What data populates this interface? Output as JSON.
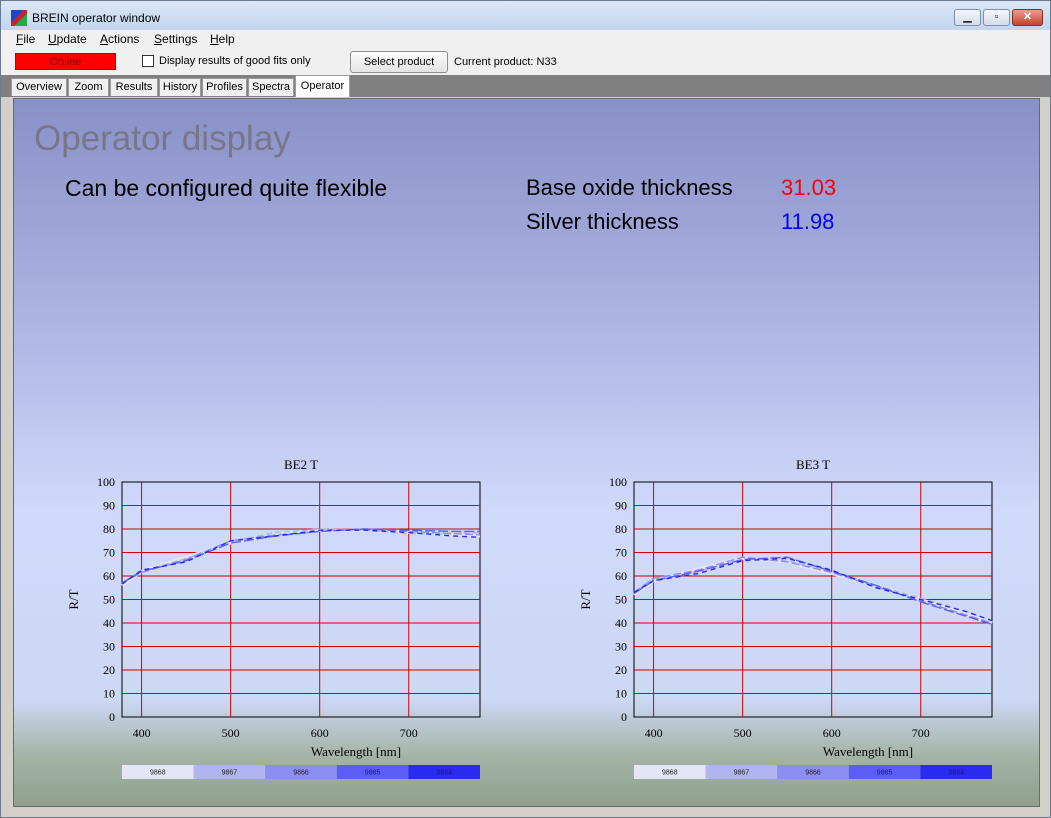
{
  "window": {
    "title": "BREIN operator window",
    "icon": "app-icon",
    "controls": {
      "minimize": "▁",
      "maximize": "▫",
      "close": "✕"
    }
  },
  "menu": [
    {
      "hot": "F",
      "rest": "ile"
    },
    {
      "hot": "U",
      "rest": "pdate"
    },
    {
      "hot": "A",
      "rest": "ctions"
    },
    {
      "hot": "S",
      "rest": "ettings"
    },
    {
      "hot": "H",
      "rest": "elp"
    }
  ],
  "toolbar": {
    "status": "Online",
    "status_color": "#ff0000",
    "checkbox_label": "Display results of good fits only",
    "checkbox_checked": false,
    "select_product_label": "Select product",
    "current_product": "Current product: N33"
  },
  "tabs": [
    "Overview",
    "Zoom",
    "Results",
    "History",
    "Profiles",
    "Spectra",
    "Operator"
  ],
  "active_tab": "Operator",
  "operator": {
    "title": "Operator display",
    "subtitle": "Can be configured quite flexible",
    "measurements": [
      {
        "label": "Base oxide thickness",
        "value": "31.03",
        "color": "#ff0000"
      },
      {
        "label": "Silver thickness",
        "value": "11.98",
        "color": "#0000ff"
      }
    ]
  },
  "chart_data": [
    {
      "type": "line",
      "title": "BE2 T",
      "xlabel": "Wavelength [nm]",
      "ylabel": "R/T",
      "xlim": [
        378,
        780
      ],
      "ylim": [
        0,
        100
      ],
      "xticks": [
        400,
        500,
        600,
        700
      ],
      "yticks": [
        0,
        10,
        20,
        30,
        40,
        50,
        60,
        70,
        80,
        90,
        100
      ],
      "grid": true,
      "grid_color": "#cc0000",
      "legend_placement": "bottom",
      "series": [
        {
          "name": "9868",
          "color": "#e4e6f8",
          "x": [
            378,
            400,
            450,
            500,
            550,
            600,
            650,
            700,
            750,
            780
          ],
          "y": [
            56,
            62,
            68,
            74,
            78,
            79.5,
            79.5,
            78.5,
            77.5,
            77
          ]
        },
        {
          "name": "9867",
          "color": "#b0b4f0",
          "x": [
            378,
            400,
            450,
            500,
            550,
            600,
            650,
            700,
            750,
            780
          ],
          "y": [
            57,
            62,
            67.5,
            74.5,
            78.5,
            80,
            79.5,
            78,
            78,
            78.5
          ]
        },
        {
          "name": "9866",
          "color": "#8a8ef0",
          "x": [
            378,
            400,
            450,
            500,
            550,
            600,
            650,
            700,
            750,
            780
          ],
          "y": [
            57,
            61.5,
            67,
            75,
            77.5,
            79,
            80,
            79,
            78,
            77.5
          ]
        },
        {
          "name": "9865",
          "color": "#5a5ef4",
          "x": [
            378,
            400,
            450,
            500,
            550,
            600,
            650,
            700,
            750,
            780
          ],
          "y": [
            57,
            62,
            66.5,
            74,
            77,
            79,
            80,
            79.5,
            79,
            79
          ]
        },
        {
          "name": "9864",
          "color": "#2a2af0",
          "x": [
            378,
            400,
            450,
            500,
            550,
            600,
            650,
            700,
            750,
            780
          ],
          "y": [
            56.5,
            62.5,
            66,
            75,
            77,
            79.5,
            79.5,
            78.5,
            77,
            76.5
          ]
        }
      ]
    },
    {
      "type": "line",
      "title": "BE3 T",
      "xlabel": "Wavelength [nm]",
      "ylabel": "R/T",
      "xlim": [
        378,
        780
      ],
      "ylim": [
        0,
        100
      ],
      "xticks": [
        400,
        500,
        600,
        700
      ],
      "yticks": [
        0,
        10,
        20,
        30,
        40,
        50,
        60,
        70,
        80,
        90,
        100
      ],
      "grid": true,
      "grid_color": "#cc0000",
      "legend_placement": "bottom",
      "series": [
        {
          "name": "9868",
          "color": "#e4e6f8",
          "x": [
            378,
            400,
            450,
            500,
            550,
            600,
            650,
            700,
            750,
            780
          ],
          "y": [
            52,
            58,
            63,
            67.5,
            66,
            61,
            56,
            50,
            44,
            40
          ]
        },
        {
          "name": "9867",
          "color": "#b0b4f0",
          "x": [
            378,
            400,
            450,
            500,
            550,
            600,
            650,
            700,
            750,
            780
          ],
          "y": [
            53,
            58.5,
            62,
            67,
            66.5,
            62,
            56,
            50.5,
            45,
            41
          ]
        },
        {
          "name": "9866",
          "color": "#8a8ef0",
          "x": [
            378,
            400,
            450,
            500,
            550,
            600,
            650,
            700,
            750,
            780
          ],
          "y": [
            53,
            59,
            62.5,
            68,
            66,
            61.5,
            55.5,
            49.5,
            43.5,
            40
          ]
        },
        {
          "name": "9865",
          "color": "#5a5ef4",
          "x": [
            378,
            400,
            450,
            500,
            550,
            600,
            650,
            700,
            750,
            780
          ],
          "y": [
            52.5,
            58,
            62,
            67,
            68,
            62,
            56,
            49,
            43,
            39.5
          ]
        },
        {
          "name": "9864",
          "color": "#2a2af0",
          "x": [
            378,
            400,
            450,
            500,
            550,
            600,
            650,
            700,
            750,
            780
          ],
          "y": [
            53,
            58,
            61,
            66.5,
            67.5,
            62.5,
            55,
            50,
            45,
            41
          ]
        }
      ]
    }
  ]
}
